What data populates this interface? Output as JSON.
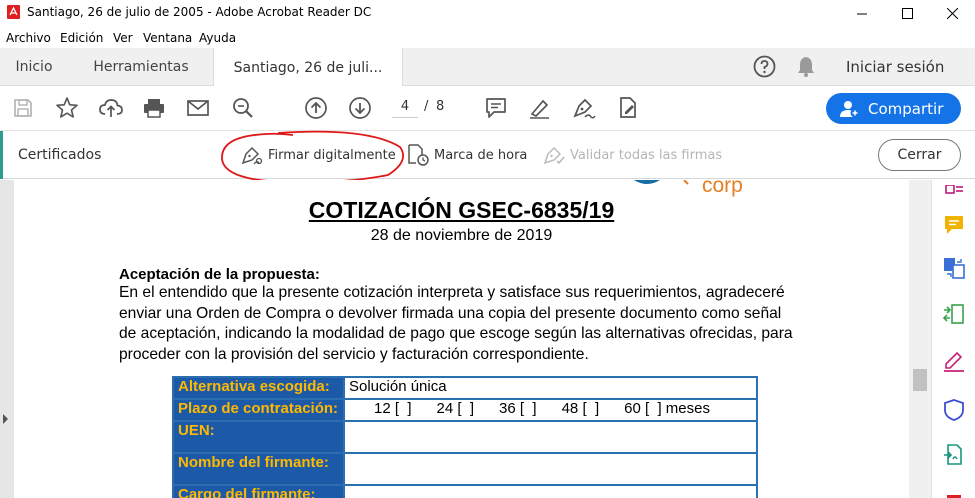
{
  "window": {
    "title": "Santiago, 26 de julio de 2005 - Adobe Acrobat Reader DC",
    "icons": [
      "acrobat-icon",
      "minimize-icon",
      "maximize-icon",
      "close-icon"
    ]
  },
  "menubar": {
    "items": [
      "Archivo",
      "Edición",
      "Ver",
      "Ventana",
      "Ayuda"
    ]
  },
  "tabs": {
    "home": "Inicio",
    "tools": "Herramientas",
    "document": "Santiago, 26 de juli...",
    "signin": "Iniciar sesión"
  },
  "toolbar": {
    "page_current": "4",
    "page_sep": "/",
    "page_total": "8",
    "share_label": "Compartir",
    "accent_color": "#1473e6"
  },
  "certbar": {
    "title": "Certificados",
    "sign_digitally": "Firmar digitalmente",
    "timestamp": "Marca de hora",
    "validate_all": "Validar todas las firmas",
    "close": "Cerrar",
    "accent_color": "#2d9b8f"
  },
  "document": {
    "logo_text": "corp",
    "title": "COTIZACIÓN GSEC-6835/19",
    "date": "28 de noviembre de 2019",
    "section_title": "Aceptación de la propuesta:",
    "body_lines": [
      "En el entendido que la presente cotización interpreta y satisface sus requerimientos, agradeceré",
      "enviar una Orden de Compra o devolver firmada una copia del presente documento como señal",
      "de aceptación, indicando la modalidad de pago que escoge según las alternativas ofrecidas, para",
      "proceder con la provisión del servicio y facturación correspondiente."
    ],
    "form_rows": [
      {
        "label": "Alternativa escogida:",
        "value": "Solución única"
      },
      {
        "label": "Plazo de contratación:",
        "value": "      12 [  ]      24 [  ]      36 [  ]      48 [  ]      60 [  ] meses"
      },
      {
        "label": "UEN:",
        "value": ""
      },
      {
        "label": "Nombre del firmante:",
        "value": ""
      },
      {
        "label": "Cargo del firmante:",
        "value": ""
      }
    ]
  }
}
